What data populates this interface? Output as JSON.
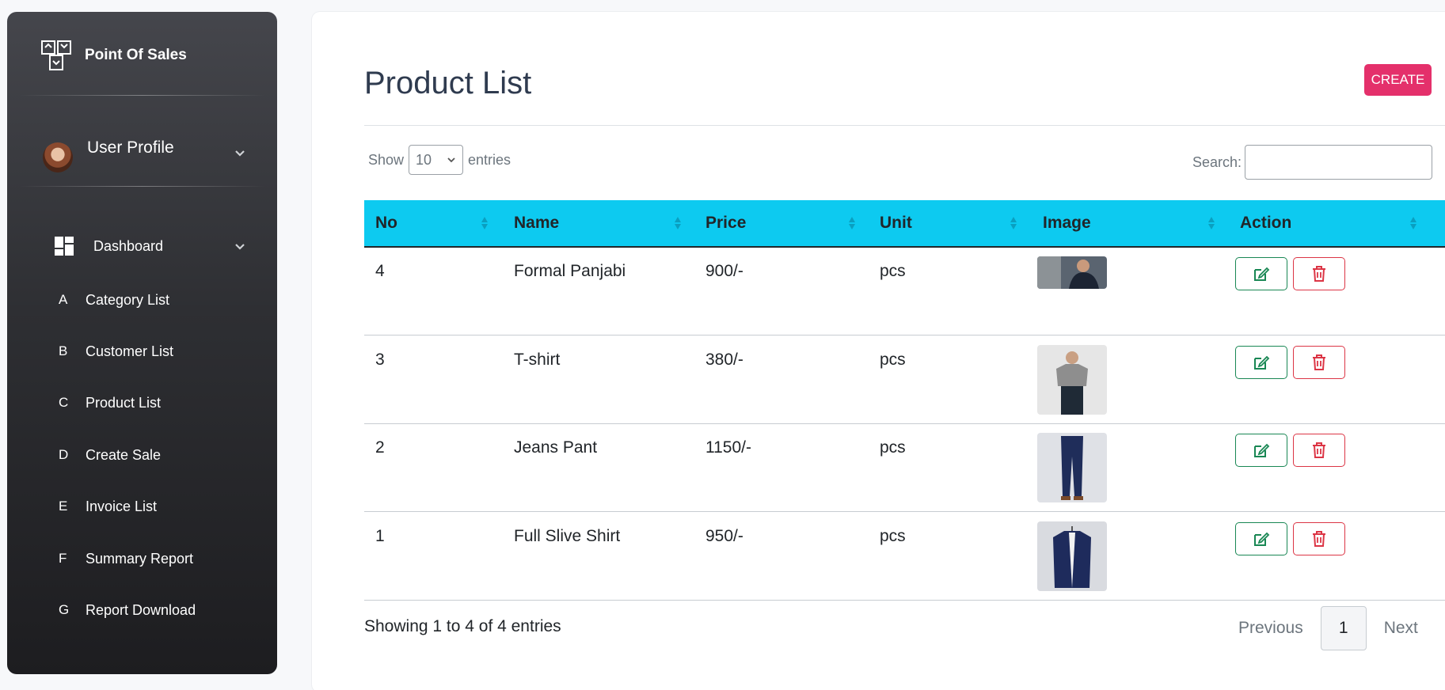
{
  "sidebar": {
    "brand": "Point Of Sales",
    "profile_label": "User Profile",
    "dashboard_label": "Dashboard",
    "items": [
      {
        "letter": "A",
        "label": "Category List"
      },
      {
        "letter": "B",
        "label": "Customer List"
      },
      {
        "letter": "C",
        "label": "Product List"
      },
      {
        "letter": "D",
        "label": "Create Sale"
      },
      {
        "letter": "E",
        "label": "Invoice List"
      },
      {
        "letter": "F",
        "label": "Summary Report"
      },
      {
        "letter": "G",
        "label": "Report Download"
      }
    ]
  },
  "main": {
    "title": "Product List",
    "create_label": "CREATE",
    "show_label": "Show",
    "entries_value": "10",
    "entries_label": "entries",
    "search_label": "Search:",
    "search_value": "",
    "columns": [
      "No",
      "Name",
      "Price",
      "Unit",
      "Image",
      "Action"
    ],
    "rows": [
      {
        "no": "4",
        "name": "Formal Panjabi",
        "price": "900/-",
        "unit": "pcs",
        "image_icon": "man-photo-thumbnail"
      },
      {
        "no": "3",
        "name": "T-shirt",
        "price": "380/-",
        "unit": "pcs",
        "image_icon": "tshirt-photo-thumbnail"
      },
      {
        "no": "2",
        "name": "Jeans Pant",
        "price": "1150/-",
        "unit": "pcs",
        "image_icon": "jeans-photo-thumbnail"
      },
      {
        "no": "1",
        "name": "Full Slive Shirt",
        "price": "950/-",
        "unit": "pcs",
        "image_icon": "shirt-photo-thumbnail"
      }
    ],
    "footer_info": "Showing 1 to 4 of 4 entries",
    "pagination": {
      "previous": "Previous",
      "current": "1",
      "next": "Next"
    },
    "colors": {
      "header_bg": "#0dcaf0",
      "create_bg": "#e4306b",
      "edit": "#198754",
      "delete": "#dc3545"
    }
  }
}
